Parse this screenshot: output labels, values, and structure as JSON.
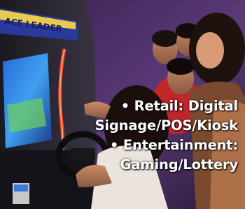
{
  "photo": {
    "cabinet_sign": "ACE LEADER"
  },
  "caption": {
    "line1": "• Retail: Digital",
    "line2": "Signage/POS/Kiosk",
    "line3": "• Entertainment:",
    "line4": "Gaming/Lottery"
  }
}
